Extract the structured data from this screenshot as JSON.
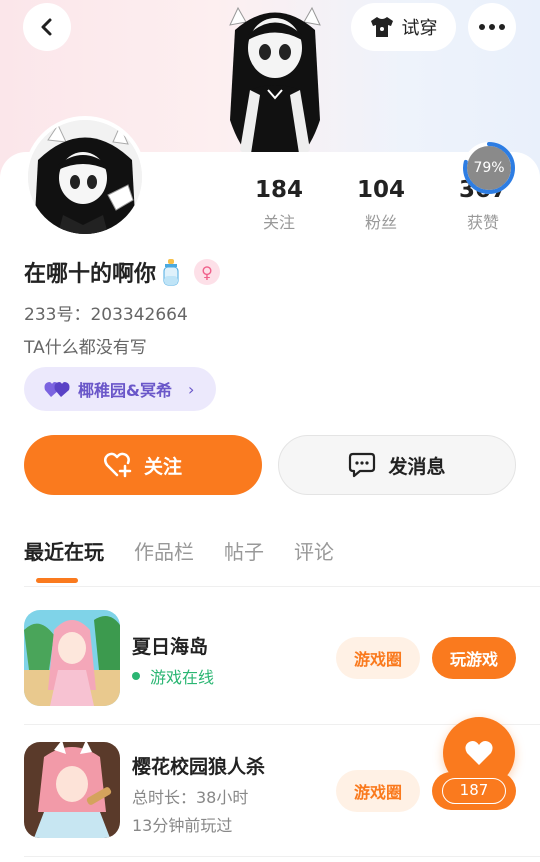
{
  "header": {
    "tryon_label": "试穿"
  },
  "stats": [
    {
      "value": "184",
      "label": "关注"
    },
    {
      "value": "104",
      "label": "粉丝"
    },
    {
      "value": "367",
      "label": "获赞"
    }
  ],
  "progress": {
    "percent_text": "79%",
    "value": 0.79
  },
  "profile": {
    "username": "在哪十的啊你",
    "gender_symbol": "♀",
    "uid": "233号：203342664",
    "bio": "TA什么都没有写",
    "club": "椰稚园&冥希"
  },
  "actions": {
    "follow_label": "关注",
    "message_label": "发消息"
  },
  "tabs": [
    "最近在玩",
    "作品栏",
    "帖子",
    "评论"
  ],
  "games": [
    {
      "title": "夏日海岛",
      "status": "游戏在线",
      "circle_label": "游戏圈",
      "play_label": "玩游戏"
    },
    {
      "title": "樱花校园狼人杀",
      "meta1": "总时长：38小时",
      "meta2": "13分钟前玩过",
      "circle_label": "游戏圈"
    }
  ],
  "likes": {
    "count": "187"
  },
  "colors": {
    "accent": "#fa7a1e",
    "online": "#2bb673",
    "club": "#6a57c9"
  }
}
